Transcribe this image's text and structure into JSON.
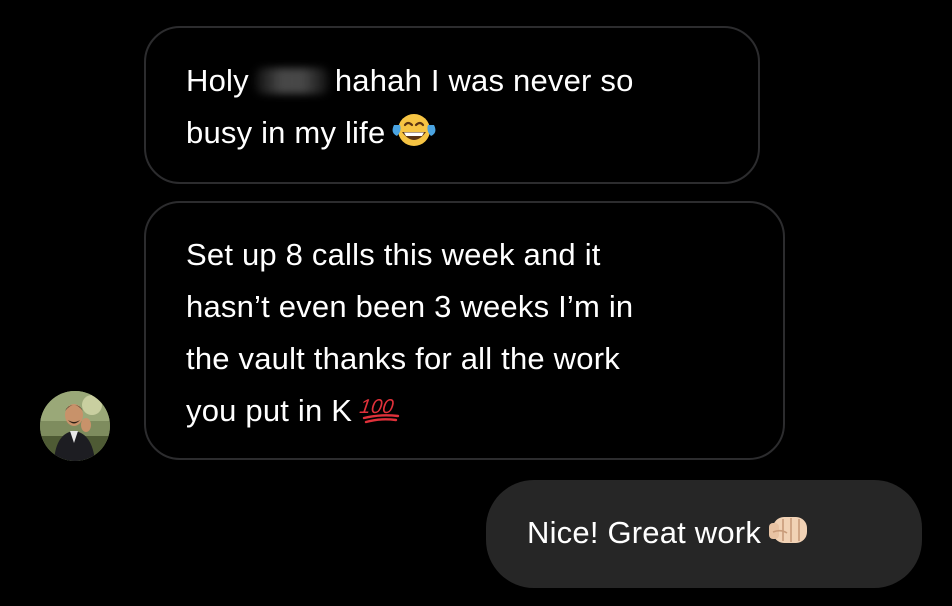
{
  "conversation": {
    "messages": [
      {
        "direction": "incoming",
        "lines": [
          {
            "before": "Holy",
            "after": "hahah I was never so"
          },
          {
            "text": "busy in my life"
          }
        ],
        "emoji": "face-with-tears-of-joy-icon"
      },
      {
        "direction": "incoming",
        "lines": [
          {
            "text": "Set up 8 calls this week and it"
          },
          {
            "text": "hasn’t even been 3 weeks I’m in"
          },
          {
            "text": "the vault thanks for all the work"
          },
          {
            "text": "you put in K"
          }
        ],
        "emoji": "hundred-points-icon"
      },
      {
        "direction": "outgoing",
        "lines": [
          {
            "text": "Nice! Great work"
          }
        ],
        "emoji": "fist-bump-icon"
      }
    ],
    "sender_avatar": "avatar"
  },
  "colors": {
    "background": "#000000",
    "incoming_border": "#2c2c2e",
    "outgoing_bubble": "#262626",
    "text": "#ffffff"
  }
}
